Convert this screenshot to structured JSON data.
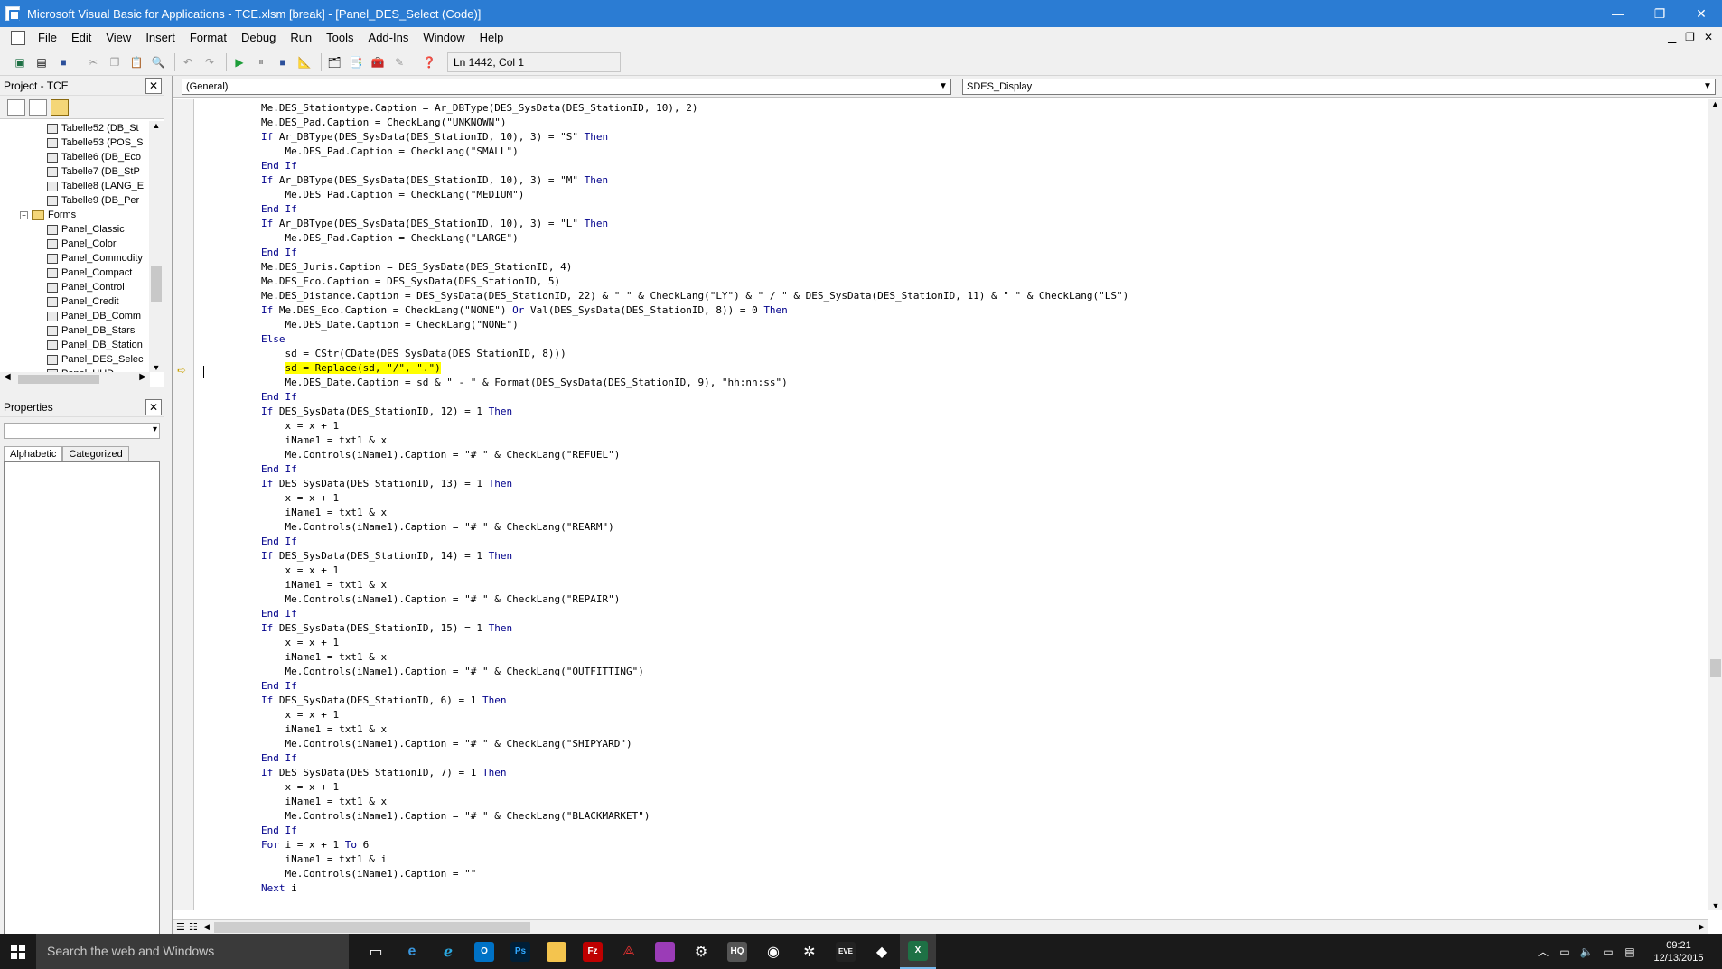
{
  "window": {
    "title": "Microsoft Visual Basic for Applications - TCE.xlsm [break] - [Panel_DES_Select (Code)]",
    "buttons": {
      "minimize": "—",
      "restore": "❐",
      "close": "✕"
    }
  },
  "menu": {
    "items": [
      "File",
      "Edit",
      "View",
      "Insert",
      "Format",
      "Debug",
      "Run",
      "Tools",
      "Add-Ins",
      "Window",
      "Help"
    ]
  },
  "toolbar": {
    "position": "Ln 1442, Col 1"
  },
  "project_pane": {
    "title": "Project - TCE",
    "tree": [
      {
        "label": "Tabelle52 (DB_St",
        "type": "sheet"
      },
      {
        "label": "Tabelle53 (POS_S",
        "type": "sheet"
      },
      {
        "label": "Tabelle6 (DB_Eco",
        "type": "sheet"
      },
      {
        "label": "Tabelle7 (DB_StP",
        "type": "sheet"
      },
      {
        "label": "Tabelle8 (LANG_E",
        "type": "sheet"
      },
      {
        "label": "Tabelle9 (DB_Per",
        "type": "sheet"
      },
      {
        "label": "Forms",
        "type": "folder"
      },
      {
        "label": "Panel_Classic",
        "type": "form"
      },
      {
        "label": "Panel_Color",
        "type": "form"
      },
      {
        "label": "Panel_Commodity",
        "type": "form"
      },
      {
        "label": "Panel_Compact",
        "type": "form"
      },
      {
        "label": "Panel_Control",
        "type": "form"
      },
      {
        "label": "Panel_Credit",
        "type": "form"
      },
      {
        "label": "Panel_DB_Comm",
        "type": "form"
      },
      {
        "label": "Panel_DB_Stars",
        "type": "form"
      },
      {
        "label": "Panel_DB_Station",
        "type": "form"
      },
      {
        "label": "Panel_DES_Selec",
        "type": "form"
      },
      {
        "label": "Panel_HUD",
        "type": "form"
      }
    ]
  },
  "properties_pane": {
    "title": "Properties",
    "tabs": [
      "Alphabetic",
      "Categorized"
    ]
  },
  "code_window": {
    "object_combo": "(General)",
    "proc_combo": "SDES_Display",
    "lines": [
      [
        [
          "",
          "Me.DES_Stationtype.Caption = Ar_DBType(DES_SysData(DES_StationID, 10), 2)"
        ]
      ],
      [
        [
          "",
          "Me.DES_Pad.Caption = CheckLang(\"UNKNOWN\")"
        ]
      ],
      [
        [
          "kw",
          "If "
        ],
        [
          "",
          "Ar_DBType(DES_SysData(DES_StationID, 10), 3) = \"S\" "
        ],
        [
          "kw",
          "Then"
        ]
      ],
      [
        [
          "",
          "    Me.DES_Pad.Caption = CheckLang(\"SMALL\")"
        ]
      ],
      [
        [
          "kw",
          "End If"
        ]
      ],
      [
        [
          "kw",
          "If "
        ],
        [
          "",
          "Ar_DBType(DES_SysData(DES_StationID, 10), 3) = \"M\" "
        ],
        [
          "kw",
          "Then"
        ]
      ],
      [
        [
          "",
          "    Me.DES_Pad.Caption = CheckLang(\"MEDIUM\")"
        ]
      ],
      [
        [
          "kw",
          "End If"
        ]
      ],
      [
        [
          "kw",
          "If "
        ],
        [
          "",
          "Ar_DBType(DES_SysData(DES_StationID, 10), 3) = \"L\" "
        ],
        [
          "kw",
          "Then"
        ]
      ],
      [
        [
          "",
          "    Me.DES_Pad.Caption = CheckLang(\"LARGE\")"
        ]
      ],
      [
        [
          "kw",
          "End If"
        ]
      ],
      [
        [
          "",
          "Me.DES_Juris.Caption = DES_SysData(DES_StationID, 4)"
        ]
      ],
      [
        [
          "",
          "Me.DES_Eco.Caption = DES_SysData(DES_StationID, 5)"
        ]
      ],
      [
        [
          "",
          "Me.DES_Distance.Caption = DES_SysData(DES_StationID, 22) & \" \" & CheckLang(\"LY\") & \" / \" & DES_SysData(DES_StationID, 11) & \" \" & CheckLang(\"LS\")"
        ]
      ],
      [
        [
          "kw",
          "If "
        ],
        [
          "",
          "Me.DES_Eco.Caption = CheckLang(\"NONE\") "
        ],
        [
          "kw",
          "Or "
        ],
        [
          "",
          "Val(DES_SysData(DES_StationID, 8)) = 0 "
        ],
        [
          "kw",
          "Then"
        ]
      ],
      [
        [
          "",
          "    Me.DES_Date.Caption = CheckLang(\"NONE\")"
        ]
      ],
      [
        [
          "kw",
          "Else"
        ]
      ],
      [
        [
          "",
          "    sd = CStr(CDate(DES_SysData(DES_StationID, 8)))"
        ]
      ],
      [
        [
          "",
          "    "
        ],
        [
          "hl",
          "sd = Replace(sd, \"/\", \".\")"
        ]
      ],
      [
        [
          "",
          "    Me.DES_Date.Caption = sd & \" - \" & Format(DES_SysData(DES_StationID, 9), \"hh:nn:ss\")"
        ]
      ],
      [
        [
          "kw",
          "End If"
        ]
      ],
      [
        [
          "kw",
          "If "
        ],
        [
          "",
          "DES_SysData(DES_StationID, 12) = 1 "
        ],
        [
          "kw",
          "Then"
        ]
      ],
      [
        [
          "",
          "    x = x + 1"
        ]
      ],
      [
        [
          "",
          "    iName1 = txt1 & x"
        ]
      ],
      [
        [
          "",
          "    Me.Controls(iName1).Caption = \"# \" & CheckLang(\"REFUEL\")"
        ]
      ],
      [
        [
          "kw",
          "End If"
        ]
      ],
      [
        [
          "kw",
          "If "
        ],
        [
          "",
          "DES_SysData(DES_StationID, 13) = 1 "
        ],
        [
          "kw",
          "Then"
        ]
      ],
      [
        [
          "",
          "    x = x + 1"
        ]
      ],
      [
        [
          "",
          "    iName1 = txt1 & x"
        ]
      ],
      [
        [
          "",
          "    Me.Controls(iName1).Caption = \"# \" & CheckLang(\"REARM\")"
        ]
      ],
      [
        [
          "kw",
          "End If"
        ]
      ],
      [
        [
          "kw",
          "If "
        ],
        [
          "",
          "DES_SysData(DES_StationID, 14) = 1 "
        ],
        [
          "kw",
          "Then"
        ]
      ],
      [
        [
          "",
          "    x = x + 1"
        ]
      ],
      [
        [
          "",
          "    iName1 = txt1 & x"
        ]
      ],
      [
        [
          "",
          "    Me.Controls(iName1).Caption = \"# \" & CheckLang(\"REPAIR\")"
        ]
      ],
      [
        [
          "kw",
          "End If"
        ]
      ],
      [
        [
          "kw",
          "If "
        ],
        [
          "",
          "DES_SysData(DES_StationID, 15) = 1 "
        ],
        [
          "kw",
          "Then"
        ]
      ],
      [
        [
          "",
          "    x = x + 1"
        ]
      ],
      [
        [
          "",
          "    iName1 = txt1 & x"
        ]
      ],
      [
        [
          "",
          "    Me.Controls(iName1).Caption = \"# \" & CheckLang(\"OUTFITTING\")"
        ]
      ],
      [
        [
          "kw",
          "End If"
        ]
      ],
      [
        [
          "kw",
          "If "
        ],
        [
          "",
          "DES_SysData(DES_StationID, 6) = 1 "
        ],
        [
          "kw",
          "Then"
        ]
      ],
      [
        [
          "",
          "    x = x + 1"
        ]
      ],
      [
        [
          "",
          "    iName1 = txt1 & x"
        ]
      ],
      [
        [
          "",
          "    Me.Controls(iName1).Caption = \"# \" & CheckLang(\"SHIPYARD\")"
        ]
      ],
      [
        [
          "kw",
          "End If"
        ]
      ],
      [
        [
          "kw",
          "If "
        ],
        [
          "",
          "DES_SysData(DES_StationID, 7) = 1 "
        ],
        [
          "kw",
          "Then"
        ]
      ],
      [
        [
          "",
          "    x = x + 1"
        ]
      ],
      [
        [
          "",
          "    iName1 = txt1 & x"
        ]
      ],
      [
        [
          "",
          "    Me.Controls(iName1).Caption = \"# \" & CheckLang(\"BLACKMARKET\")"
        ]
      ],
      [
        [
          "kw",
          "End If"
        ]
      ],
      [
        [
          "kw",
          "For "
        ],
        [
          "",
          "i = x + 1 "
        ],
        [
          "kw",
          "To "
        ],
        [
          "",
          "6"
        ]
      ],
      [
        [
          "",
          "    iName1 = txt1 & i"
        ]
      ],
      [
        [
          "",
          "    Me.Controls(iName1).Caption = \"\""
        ]
      ],
      [
        [
          "kw",
          "Next "
        ],
        [
          "",
          "i"
        ]
      ]
    ]
  },
  "taskbar": {
    "search_placeholder": "Search the web and Windows",
    "time": "09:21",
    "date": "12/13/2015",
    "colors": {
      "accent": "#2b7cd3",
      "taskbar": "#1a1a1a",
      "highlight": "#ffff00",
      "keyword": "#00008b"
    }
  }
}
